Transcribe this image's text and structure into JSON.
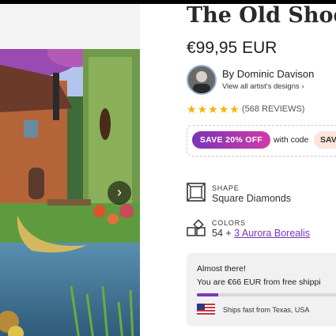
{
  "product": {
    "title": "The Old Shoe",
    "price": "€99,95 EUR"
  },
  "artist": {
    "by_label": "By Dominic Davison",
    "link_label": "View all artist's designs ›"
  },
  "rating": {
    "stars": 5,
    "reviews_label": "(568 REVIEWS)"
  },
  "promo": {
    "badge": "SAVE 20% OFF",
    "text": "with code",
    "code": "SAV"
  },
  "features": {
    "shape_label": "SHAPE",
    "shape_value": "Square Diamonds",
    "colors_label": "COLORS",
    "colors_value_prefix": "54 + ",
    "colors_link": "3 Aurora Borealis"
  },
  "shipping": {
    "almost": "Almost there!",
    "free_shipping": "You are €66 EUR from free shippi",
    "progress_fraction": 0.15,
    "ships_from": "Ships fast from Texas, USA"
  },
  "gallery": {
    "next_icon": "chevron-right-icon"
  },
  "colors": {
    "accent": "#7a35b8",
    "star": "#f4b400"
  }
}
